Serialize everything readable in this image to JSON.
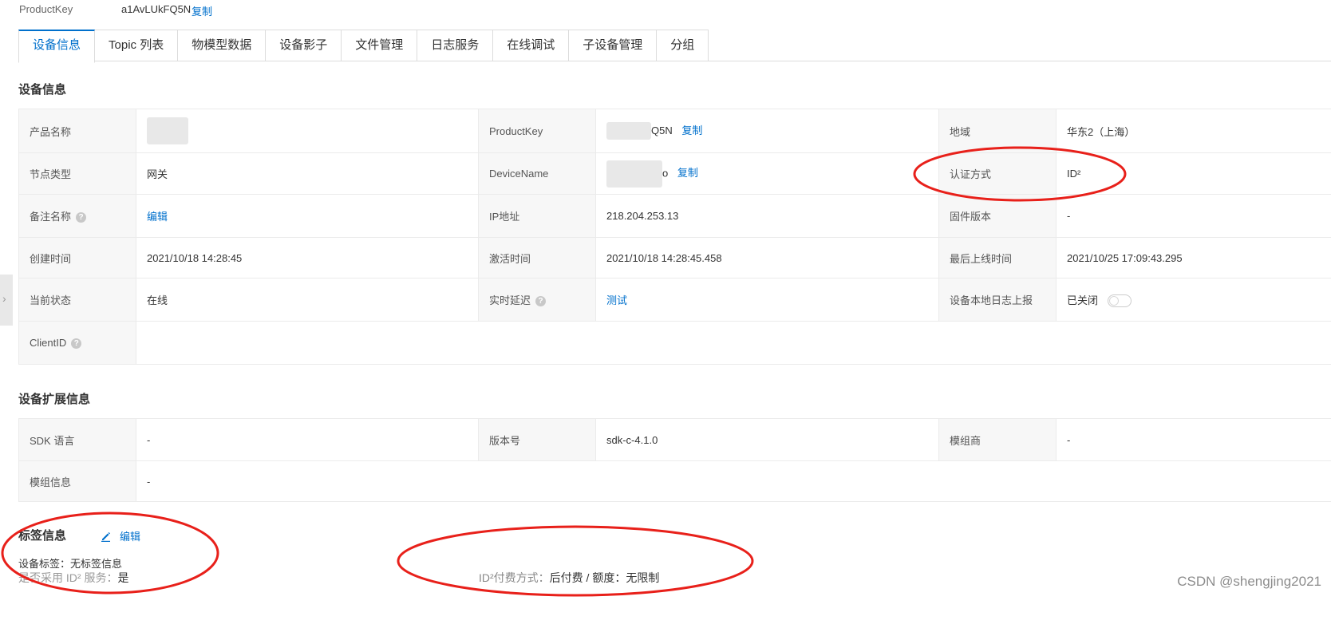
{
  "header": {
    "productkey_label": "ProductKey",
    "productkey_value": "a1AvLUkFQ5N",
    "copy_label": "复制"
  },
  "tabs": [
    {
      "label": "设备信息",
      "active": true
    },
    {
      "label": "Topic 列表",
      "active": false
    },
    {
      "label": "物模型数据",
      "active": false
    },
    {
      "label": "设备影子",
      "active": false
    },
    {
      "label": "文件管理",
      "active": false
    },
    {
      "label": "日志服务",
      "active": false
    },
    {
      "label": "在线调试",
      "active": false
    },
    {
      "label": "子设备管理",
      "active": false
    },
    {
      "label": "分组",
      "active": false
    }
  ],
  "device_info": {
    "title": "设备信息",
    "product_name_label": "产品名称",
    "productkey_label": "ProductKey",
    "productkey_value": "Q5N",
    "copy_label": "复制",
    "region_label": "地域",
    "region_value": "华东2（上海）",
    "node_type_label": "节点类型",
    "node_type_value": "网关",
    "devicename_label": "DeviceName",
    "devicename_value": "o",
    "auth_label": "认证方式",
    "auth_value": "ID²",
    "remark_label": "备注名称",
    "remark_value": "编辑",
    "ip_label": "IP地址",
    "ip_value": "218.204.253.13",
    "firmware_label": "固件版本",
    "firmware_value": "-",
    "created_label": "创建时间",
    "created_value": "2021/10/18 14:28:45",
    "activated_label": "激活时间",
    "activated_value": "2021/10/18 14:28:45.458",
    "last_online_label": "最后上线时间",
    "last_online_value": "2021/10/25 17:09:43.295",
    "status_label": "当前状态",
    "status_value": "在线",
    "latency_label": "实时延迟",
    "latency_value": "测试",
    "local_log_label": "设备本地日志上报",
    "local_log_value": "已关闭",
    "clientid_label": "ClientID"
  },
  "ext_info": {
    "title": "设备扩展信息",
    "sdk_label": "SDK 语言",
    "sdk_value": "-",
    "version_label": "版本号",
    "version_value": "sdk-c-4.1.0",
    "module_vendor_label": "模组商",
    "module_vendor_value": "-",
    "module_info_label": "模组信息",
    "module_info_value": "-"
  },
  "tags": {
    "title": "标签信息",
    "edit_label": "编辑",
    "device_tag_label": "设备标签：",
    "device_tag_value": "无标签信息"
  },
  "id2": {
    "service_label": "是否采用 ID² 服务：",
    "service_value": "是",
    "pay_label": "ID²付费方式：",
    "pay_value": "后付费 / 额度：无限制"
  },
  "watermark": "CSDN @shengjing2021",
  "colors": {
    "link": "#0070cc",
    "annotation": "#e8201a",
    "label_bg": "#f7f7f7",
    "border": "#ebebeb"
  }
}
